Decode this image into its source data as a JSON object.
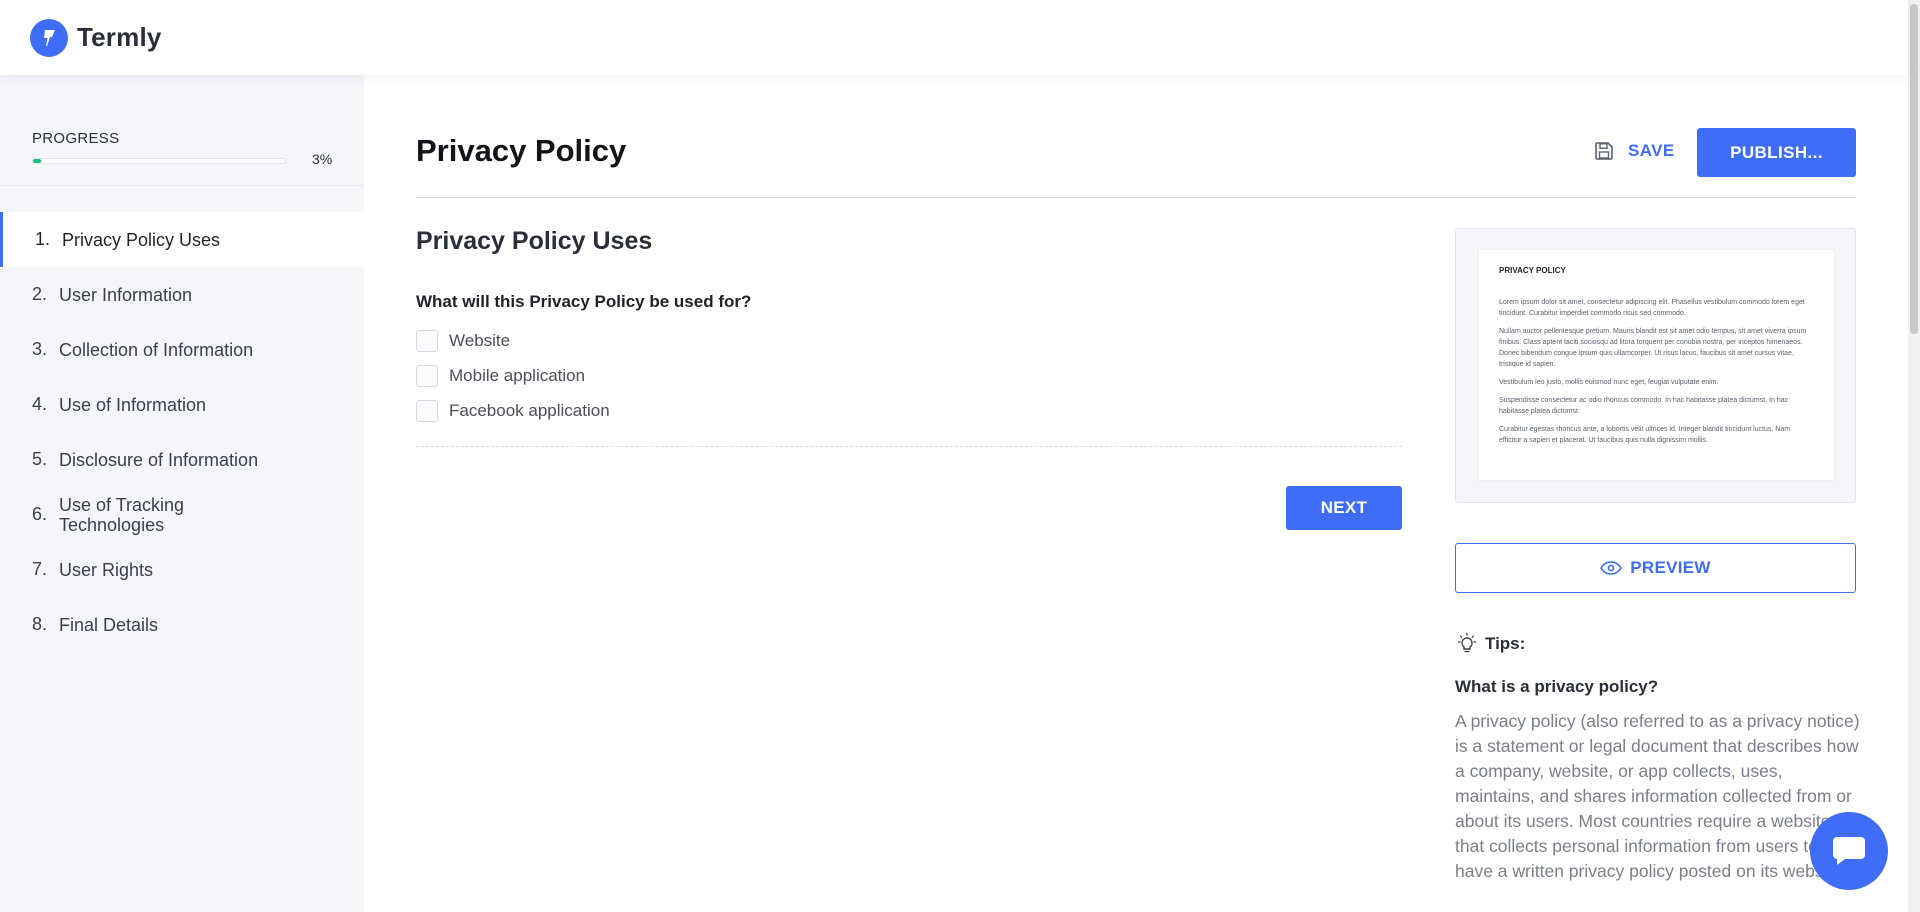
{
  "brand": {
    "name": "Termly"
  },
  "sidebar": {
    "progress_label": "PROGRESS",
    "progress_percent": "3%",
    "progress_fraction": 0.03,
    "items": [
      {
        "num": "1.",
        "label": "Privacy Policy Uses",
        "active": true
      },
      {
        "num": "2.",
        "label": "User Information"
      },
      {
        "num": "3.",
        "label": "Collection of Information"
      },
      {
        "num": "4.",
        "label": "Use of Information"
      },
      {
        "num": "5.",
        "label": "Disclosure of Information"
      },
      {
        "num": "6.",
        "label": "Use of Tracking Technologies"
      },
      {
        "num": "7.",
        "label": "User Rights"
      },
      {
        "num": "8.",
        "label": "Final Details"
      }
    ]
  },
  "header": {
    "title": "Privacy Policy",
    "save_label": "SAVE",
    "publish_label": "PUBLISH..."
  },
  "form": {
    "section_title": "Privacy Policy Uses",
    "question": "What will this Privacy Policy be used for?",
    "options": [
      "Website",
      "Mobile application",
      "Facebook application"
    ],
    "next_label": "NEXT"
  },
  "document_preview": {
    "title": "PRIVACY POLICY",
    "paragraphs": [
      "Lorem ipsum dolor sit amet, consectetur adipiscing elit. Phasellus vestibulum commodo lorem eget tincidunt. Curabitur imperdiet commodo risus sed commodo.",
      "Nullam auctor pellentesque pretium. Mauris blandit est sit amet odio tempus, sit amet viverra ipsum finibus. Class aptent taciti sociosqu ad litora torquent per conubia nostra, per inceptos himenaeos. Donec bibendum congue ipsum quis ullamcorper. Ut risus lacus, faucibus sit amet cursus vitae, tristique id sapien.",
      "Vestibulum leo justo, mollis euismod nunc eget, feugiat vulputate enim.",
      "Suspendisse consectetur ac odio rhoncus commodo. In hac habitasse platea dictumst. In hac habitasse platea dictumst.",
      "Curabitur egestas rhoncus ante, a lobortis velit ultrices id. Integer blandit tincidunt luctus. Nam efficitur a sapien et placerat. Ut faucibus quis nulla dignissim mollis."
    ],
    "preview_label": "PREVIEW"
  },
  "tips": {
    "heading": "Tips:",
    "question": "What is a privacy policy?",
    "body": "A privacy policy (also referred to as a privacy notice) is a statement or legal document that describes how a company, website, or app collects, uses, maintains, and shares information collected from or about its users. Most countries require a website that collects personal information from users to have a written privacy policy posted on its website."
  },
  "colors": {
    "accent": "#3f6df6",
    "progress": "#1cc07a",
    "sidebar_bg": "#f4f6fa"
  },
  "icons": {
    "logo": "termly-logo-icon",
    "save": "floppy-disk-icon",
    "preview": "eye-icon",
    "tips": "lightbulb-icon",
    "chat": "chat-bubble-icon"
  }
}
